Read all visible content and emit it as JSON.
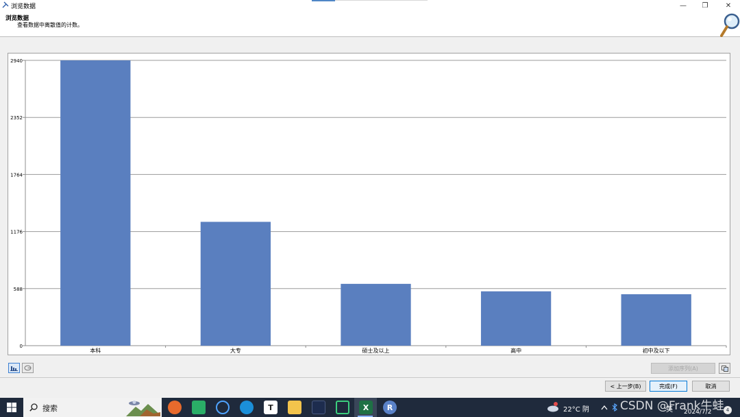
{
  "window": {
    "title": "浏览数据",
    "minimize_glyph": "—",
    "maximize_glyph": "❐",
    "close_glyph": "✕"
  },
  "header": {
    "heading": "浏览数据",
    "description": "查看数据中离散值的计数。"
  },
  "chart_data": {
    "type": "bar",
    "categories": [
      "本科",
      "大专",
      "硕士及以上",
      "高中",
      "初中及以下"
    ],
    "values": [
      2940,
      1276,
      637,
      560,
      530
    ],
    "y_ticks": [
      "0",
      "588",
      "1176",
      "1764",
      "2352",
      "2940"
    ],
    "ylim": [
      0,
      2940
    ],
    "grid": true,
    "bar_color": "#5a7fbf"
  },
  "chart_toolbar": {
    "bar_view_icon": "bar-chart-icon",
    "pie_view_icon": "pie-chart-icon",
    "add_series_label": "添加序列(A)",
    "copy_icon": "copy-icon"
  },
  "footer": {
    "back_label": "< 上一步(B)",
    "finish_label": "完成(F)",
    "cancel_label": "取消"
  },
  "taskbar": {
    "search_label": "搜索",
    "apps": [
      "firefox-icon",
      "wechat-icon",
      "search-app-icon",
      "edge-icon",
      "typora-icon",
      "file-explorer-icon",
      "terminal-icon",
      "remote-icon",
      "excel-icon",
      "r-icon"
    ],
    "typora_glyph": "T",
    "excel_glyph": "X",
    "r_glyph": "R",
    "weather": "22°C 阴",
    "date": "2024/7/2",
    "ime": "英",
    "notification_count": "4"
  },
  "watermark": "CSDN @Frank牛蛙"
}
